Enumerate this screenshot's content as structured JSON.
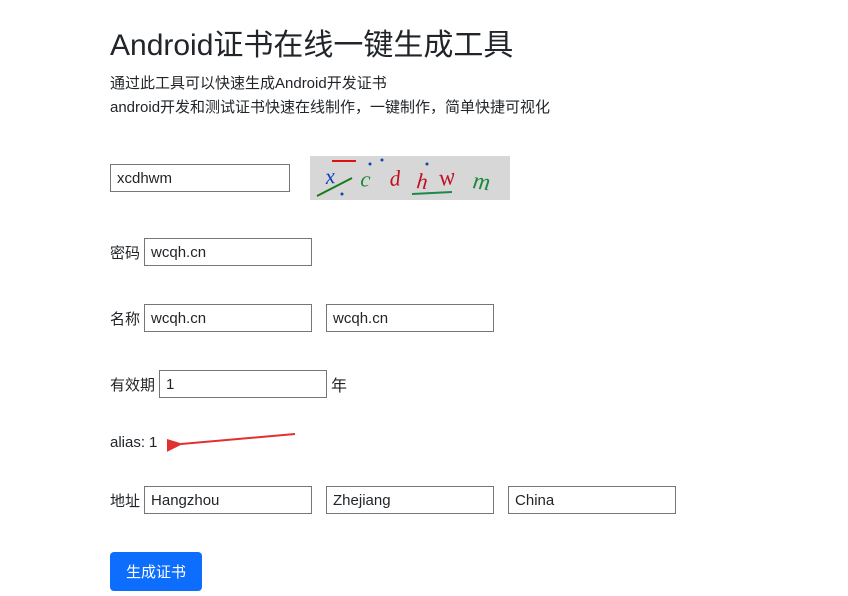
{
  "header": {
    "title": "Android证书在线一键生成工具",
    "subtitle_line1": "通过此工具可以快速生成Android开发证书",
    "subtitle_line2": "android开发和测试证书快速在线制作，一键制作，简单快捷可视化"
  },
  "captcha": {
    "value": "xcdhwm",
    "image_text": "xcdhwm"
  },
  "fields": {
    "password_label": "密码",
    "password_value": "wcqh.cn",
    "name_label": "名称",
    "name_value_1": "wcqh.cn",
    "name_value_2": "wcqh.cn",
    "validity_label": "有效期",
    "validity_value": "1",
    "validity_unit": "年",
    "alias_label": "alias:",
    "alias_value": "1",
    "address_label": "地址",
    "address_city": "Hangzhou",
    "address_province": "Zhejiang",
    "address_country": "China"
  },
  "actions": {
    "submit_label": "生成证书"
  }
}
